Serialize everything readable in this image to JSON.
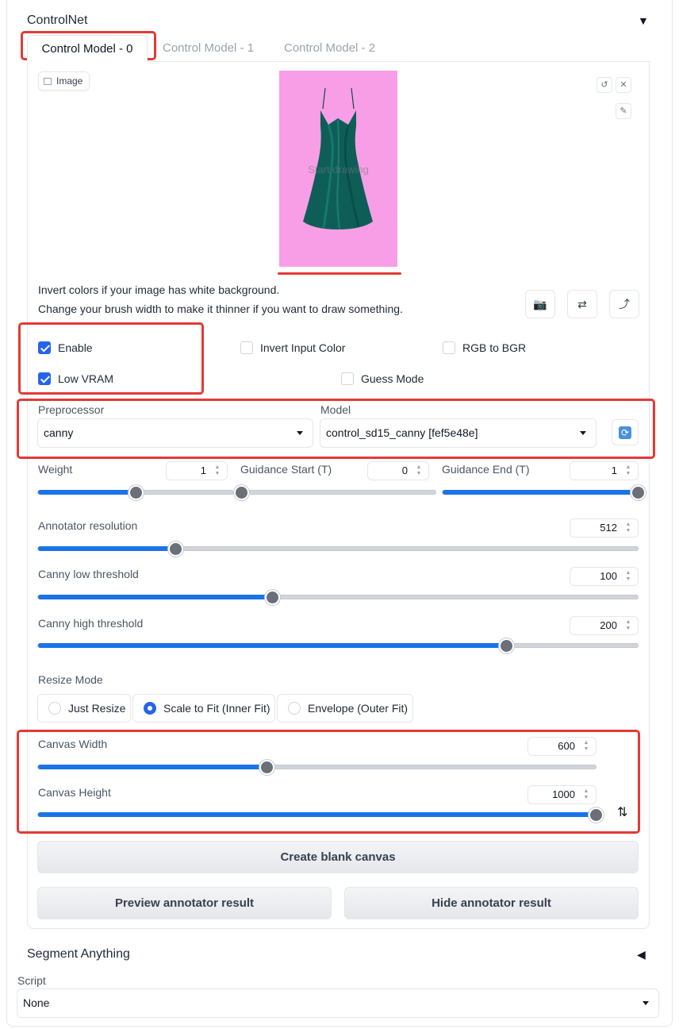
{
  "controlnet": {
    "title": "ControlNet",
    "collapse_arrow": "▼",
    "tabs": [
      {
        "label": "Control Model - 0"
      },
      {
        "label": "Control Model - 1"
      },
      {
        "label": "Control Model - 2"
      }
    ]
  },
  "image": {
    "label": "Image",
    "overlay_text": "Start drawing"
  },
  "hints": {
    "line1": "Invert colors if your image has white background.",
    "line2": "Change your brush width to make it thinner if you want to draw something."
  },
  "checkboxes": {
    "enable": {
      "label": "Enable",
      "checked": true
    },
    "invert_input_color": {
      "label": "Invert Input Color",
      "checked": false
    },
    "rgb_to_bgr": {
      "label": "RGB to BGR",
      "checked": false
    },
    "low_vram": {
      "label": "Low VRAM",
      "checked": true
    },
    "guess_mode": {
      "label": "Guess Mode",
      "checked": false
    }
  },
  "preprocessor": {
    "label": "Preprocessor",
    "value": "canny"
  },
  "model": {
    "label": "Model",
    "value": "control_sd15_canny [fef5e48e]"
  },
  "sliders": {
    "weight": {
      "label": "Weight",
      "value": "1",
      "fraction": 0.5
    },
    "guidance_start": {
      "label": "Guidance Start (T)",
      "value": "0",
      "fraction": 0.0
    },
    "guidance_end": {
      "label": "Guidance End (T)",
      "value": "1",
      "fraction": 1.0
    },
    "annotator_resolution": {
      "label": "Annotator resolution",
      "value": "512",
      "fraction": 0.23
    },
    "canny_low": {
      "label": "Canny low threshold",
      "value": "100",
      "fraction": 0.39
    },
    "canny_high": {
      "label": "Canny high threshold",
      "value": "200",
      "fraction": 0.78
    },
    "canvas_width": {
      "label": "Canvas Width",
      "value": "600",
      "fraction": 0.41
    },
    "canvas_height": {
      "label": "Canvas Height",
      "value": "1000",
      "fraction": 1.0
    }
  },
  "resize_mode": {
    "label": "Resize Mode",
    "options": [
      {
        "label": "Just Resize",
        "selected": false
      },
      {
        "label": "Scale to Fit (Inner Fit)",
        "selected": true
      },
      {
        "label": "Envelope (Outer Fit)",
        "selected": false
      }
    ]
  },
  "buttons": {
    "create_blank_canvas": "Create blank canvas",
    "preview_annotator": "Preview annotator result",
    "hide_annotator": "Hide annotator result"
  },
  "segment_anything": {
    "title": "Segment Anything",
    "arrow": "◀"
  },
  "script": {
    "label": "Script",
    "value": "None"
  },
  "colors": {
    "accent": "#2563eb",
    "slider_fill": "#1a73e8",
    "highlight": "#e53935",
    "image_bg": "#f79ee6",
    "dress": "#0e5e57"
  },
  "icons": [
    "image-icon",
    "undo-icon",
    "close-icon",
    "brush-icon",
    "camera-icon",
    "swap-icon",
    "send-icon",
    "refresh-icon",
    "swap-vertical-icon"
  ]
}
